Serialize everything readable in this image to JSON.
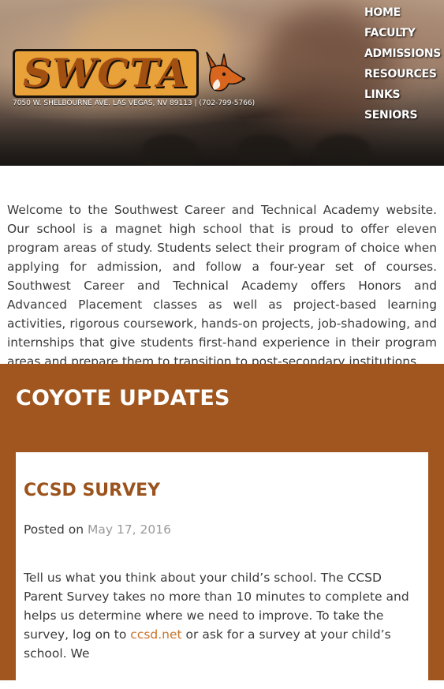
{
  "header": {
    "logo_text": "SWCTA",
    "address": "7050 W. SHELBOURNE AVE. LAS VEGAS, NV 89113 | (702-799-5766)",
    "logo_icon": "fox-icon"
  },
  "nav": {
    "items": [
      {
        "label": "HOME"
      },
      {
        "label": "FACULTY"
      },
      {
        "label": "ADMISSIONS"
      },
      {
        "label": "RESOURCES"
      },
      {
        "label": "LINKS"
      },
      {
        "label": "SENIORS"
      }
    ]
  },
  "intro": {
    "text": "Welcome to the Southwest Career and Technical Academy website. Our school is a magnet high school that is proud to offer eleven program areas of study. Students select their program of choice when applying for admission, and follow a four-year set of courses. Southwest Career and Technical Academy offers Honors and Advanced Placement classes as well as project-based learning activities, rigorous coursework, hands-on projects, job-shadowing, and internships that give students first-hand experience in their program areas and prepare them to transition to post-secondary institutions."
  },
  "updates": {
    "heading": "COYOTE UPDATES",
    "post": {
      "title": "CCSD SURVEY",
      "posted_label": "Posted on",
      "date": "May 17, 2016",
      "body_before": "Tell us what you think about your child’s school. The CCSD Parent Survey takes no more than 10 minutes to complete and helps us determine where we need to improve. To take the survey, log on to ",
      "link_text": "ccsd.net",
      "body_after": " or ask for a survey at your child’s school. We"
    }
  },
  "colors": {
    "accent": "#a0561e",
    "link": "#c8742c",
    "title": "#9b531d"
  }
}
